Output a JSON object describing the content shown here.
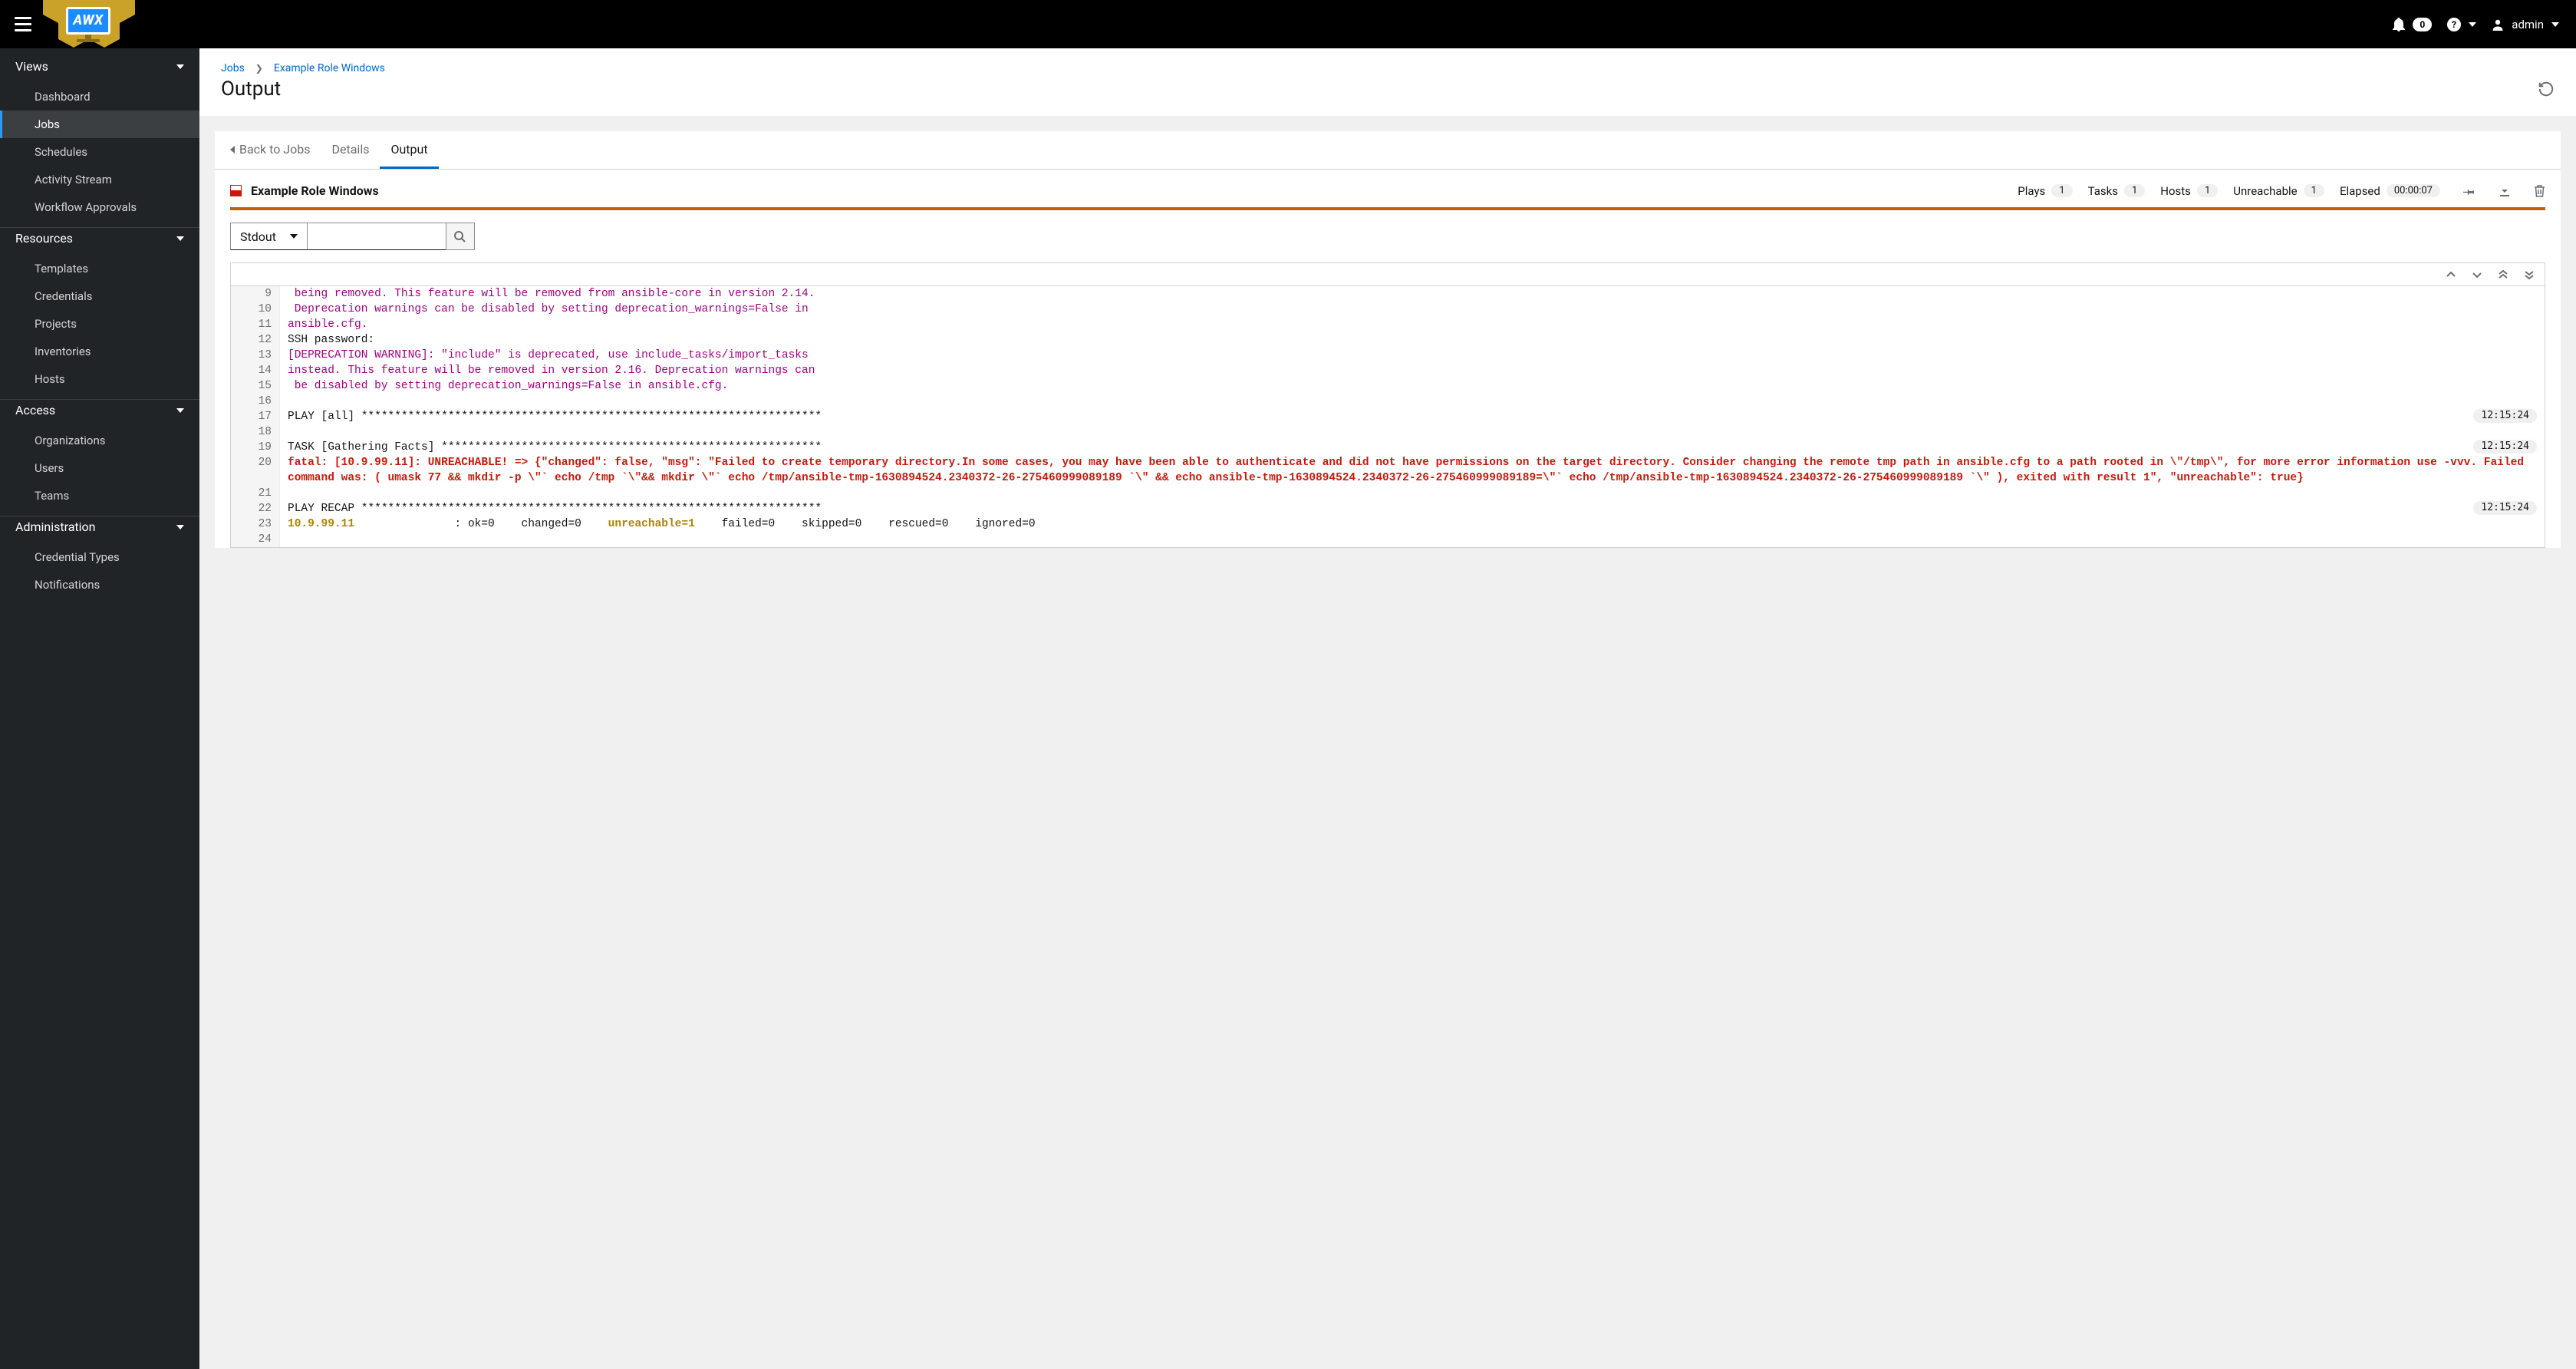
{
  "header": {
    "logo_text": "AWX",
    "notification_count": "0",
    "username": "admin"
  },
  "sidebar": {
    "sections": [
      {
        "title": "Views",
        "items": [
          {
            "label": "Dashboard",
            "active": false
          },
          {
            "label": "Jobs",
            "active": true
          },
          {
            "label": "Schedules",
            "active": false
          },
          {
            "label": "Activity Stream",
            "active": false
          },
          {
            "label": "Workflow Approvals",
            "active": false
          }
        ]
      },
      {
        "title": "Resources",
        "items": [
          {
            "label": "Templates",
            "active": false
          },
          {
            "label": "Credentials",
            "active": false
          },
          {
            "label": "Projects",
            "active": false
          },
          {
            "label": "Inventories",
            "active": false
          },
          {
            "label": "Hosts",
            "active": false
          }
        ]
      },
      {
        "title": "Access",
        "items": [
          {
            "label": "Organizations",
            "active": false
          },
          {
            "label": "Users",
            "active": false
          },
          {
            "label": "Teams",
            "active": false
          }
        ]
      },
      {
        "title": "Administration",
        "items": [
          {
            "label": "Credential Types",
            "active": false
          },
          {
            "label": "Notifications",
            "active": false
          }
        ]
      }
    ]
  },
  "breadcrumb": {
    "jobs": "Jobs",
    "current": "Example Role Windows"
  },
  "page_title": "Output",
  "tabs": {
    "back": "Back to Jobs",
    "details": "Details",
    "output": "Output"
  },
  "job": {
    "name": "Example Role Windows",
    "stats": [
      {
        "label": "Plays",
        "value": "1"
      },
      {
        "label": "Tasks",
        "value": "1"
      },
      {
        "label": "Hosts",
        "value": "1"
      },
      {
        "label": "Unreachable",
        "value": "1"
      }
    ],
    "elapsed_label": "Elapsed",
    "elapsed_value": "00:00:07"
  },
  "filter": {
    "dropdown": "Stdout"
  },
  "output_lines": [
    {
      "n": "9",
      "cls": "c-magenta",
      "text": " being removed. This feature will be removed from ansible-core in version 2.14."
    },
    {
      "n": "10",
      "cls": "c-magenta",
      "text": " Deprecation warnings can be disabled by setting deprecation_warnings=False in"
    },
    {
      "n": "11",
      "cls": "c-magenta",
      "text": "ansible.cfg."
    },
    {
      "n": "12",
      "cls": "c-default",
      "text": "SSH password: "
    },
    {
      "n": "13",
      "cls": "c-magenta",
      "text": "[DEPRECATION WARNING]: \"include\" is deprecated, use include_tasks/import_tasks"
    },
    {
      "n": "14",
      "cls": "c-magenta",
      "text": "instead. This feature will be removed in version 2.16. Deprecation warnings can"
    },
    {
      "n": "15",
      "cls": "c-magenta",
      "text": " be disabled by setting deprecation_warnings=False in ansible.cfg."
    },
    {
      "n": "16",
      "cls": "c-default",
      "text": ""
    },
    {
      "n": "17",
      "cls": "c-default",
      "text": "PLAY [all] *********************************************************************",
      "ts": "12:15:24"
    },
    {
      "n": "18",
      "cls": "c-default",
      "text": ""
    },
    {
      "n": "19",
      "cls": "c-default",
      "text": "TASK [Gathering Facts] *********************************************************",
      "ts": "12:15:24"
    },
    {
      "n": "20",
      "cls": "c-red",
      "text": "fatal: [10.9.99.11]: UNREACHABLE! => {\"changed\": false, \"msg\": \"Failed to create temporary directory.In some cases, you may have been able to authenticate and did not have permissions on the target directory. Consider changing the remote tmp path in ansible.cfg to a path rooted in \\\"/tmp\\\", for more error information use -vvv. Failed command was: ( umask 77 && mkdir -p \\\"` echo /tmp `\\\"&& mkdir \\\"` echo /tmp/ansible-tmp-1630894524.2340372-26-275460999089189 `\\\" && echo ansible-tmp-1630894524.2340372-26-275460999089189=\\\"` echo /tmp/ansible-tmp-1630894524.2340372-26-275460999089189 `\\\" ), exited with result 1\", \"unreachable\": true}"
    },
    {
      "n": "21",
      "cls": "c-default",
      "text": ""
    },
    {
      "n": "22",
      "cls": "c-default",
      "text": "PLAY RECAP *********************************************************************",
      "ts": "12:15:24"
    },
    {
      "n": "23",
      "cls": "recap",
      "text": ""
    },
    {
      "n": "24",
      "cls": "c-default",
      "text": ""
    }
  ],
  "recap": {
    "host": "10.9.99.11",
    "ok": "ok=0",
    "changed": "changed=0",
    "unreachable": "unreachable=1",
    "failed": "failed=0",
    "skipped": "skipped=0",
    "rescued": "rescued=0",
    "ignored": "ignored=0"
  }
}
